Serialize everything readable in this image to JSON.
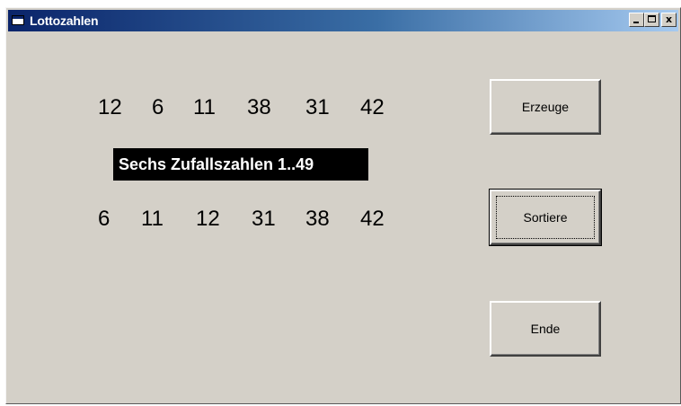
{
  "window": {
    "title": "Lottozahlen",
    "minimize_glyph": "minimize-icon",
    "maximize_glyph": "maximize-icon",
    "close_label": "x"
  },
  "numbers": {
    "random": [
      "12",
      "6",
      "11",
      "38",
      "31",
      "42"
    ],
    "sorted": [
      "6",
      "11",
      "12",
      "31",
      "38",
      "42"
    ]
  },
  "caption": "Sechs Zufallszahlen 1..49",
  "buttons": {
    "generate": "Erzeuge",
    "sort": "Sortiere",
    "end": "Ende"
  }
}
